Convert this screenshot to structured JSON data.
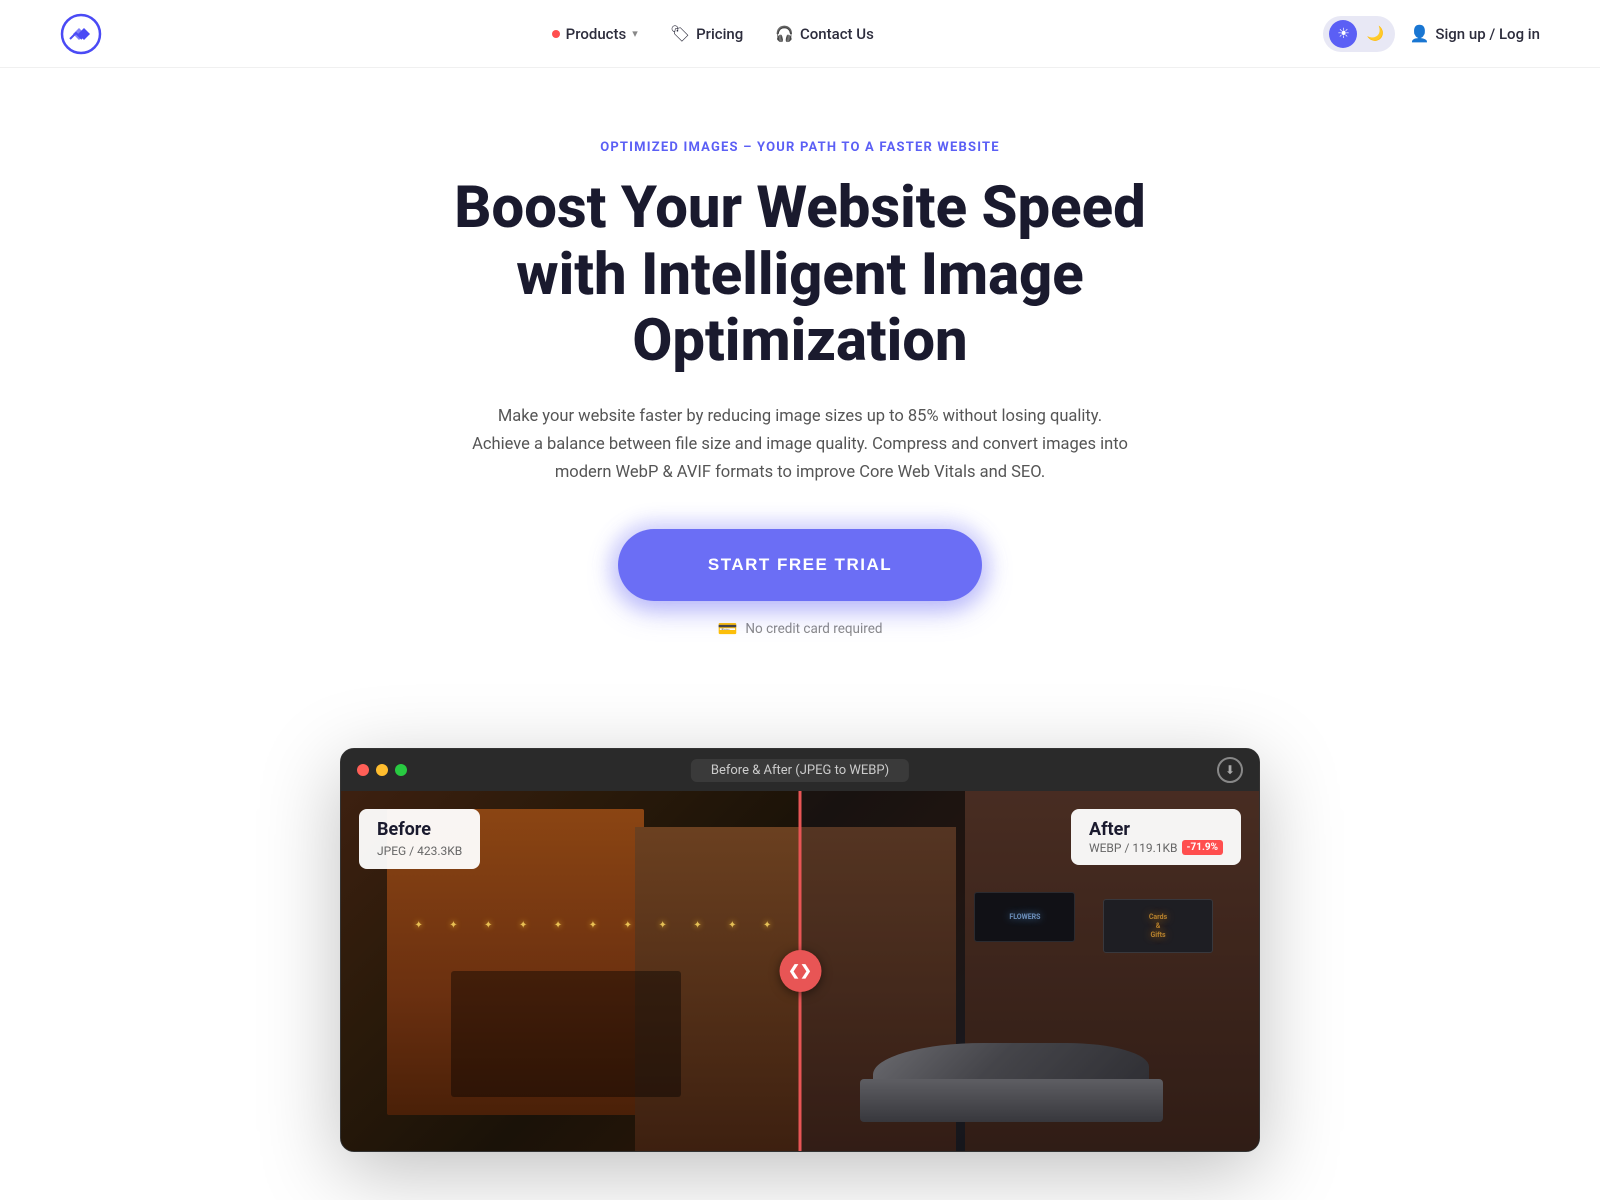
{
  "nav": {
    "logo_alt": "Optimole logo",
    "products_label": "Products",
    "pricing_label": "Pricing",
    "contact_label": "Contact Us",
    "signin_label": "Sign up / Log in",
    "theme_sun": "☀",
    "theme_moon": "🌙"
  },
  "hero": {
    "tagline": "OPTIMIZED IMAGES – YOUR PATH TO A FASTER WEBSITE",
    "title_line1": "Boost Your Website Speed",
    "title_line2": "with Intelligent Image",
    "title_line3": "Optimization",
    "description": "Make your website faster by reducing image sizes up to 85% without losing quality. Achieve a balance between file size and image quality. Compress and convert images into modern WebP & AVIF formats to improve Core Web Vitals and SEO.",
    "cta_label": "START FREE TRIAL",
    "no_credit": "No credit card required"
  },
  "demo": {
    "title": "Before & After (JPEG to WEBP)",
    "before_label": "Before",
    "before_sub": "JPEG / 423.3KB",
    "after_label": "After",
    "after_sub": "WEBP / 119.1KB",
    "reduction": "-71.9%",
    "sign_right_text": "Cards & Gifts",
    "sign_mid_text": "FLOWERS",
    "handle_icon": "❮❯"
  }
}
